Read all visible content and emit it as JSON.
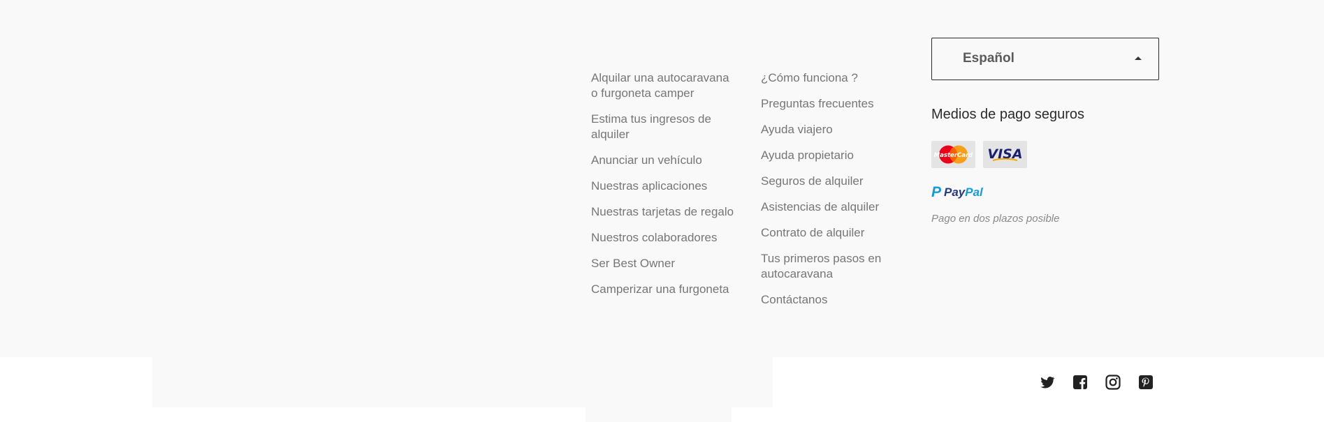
{
  "footer": {
    "column_1": [
      "Alquilar una autocaravana o furgoneta camper",
      "Estima tus ingresos de alquiler",
      "Anunciar un vehículo",
      "Nuestras aplicaciones",
      "Nuestras tarjetas de regalo",
      "Nuestros colaboradores",
      "Ser Best Owner",
      "Camperizar una furgoneta"
    ],
    "column_2": [
      "¿Cómo funciona ?",
      "Preguntas frecuentes",
      "Ayuda viajero",
      "Ayuda propietario",
      "Seguros de alquiler",
      "Asistencias de alquiler",
      "Contrato de alquiler",
      "Tus primeros pasos en autocaravana",
      "Contáctanos"
    ],
    "language": {
      "selected": "Español"
    },
    "payments": {
      "title": "Medios de pago seguros",
      "cards": [
        "MasterCard",
        "VISA"
      ],
      "paypal": {
        "pay": "Pay",
        "pal": "Pal"
      },
      "note": "Pago en dos plazos posible"
    },
    "social_icons": [
      "twitter-icon",
      "facebook-icon",
      "instagram-icon",
      "pinterest-icon"
    ]
  },
  "colors": {
    "background": "#f9f9f9",
    "link": "#767676",
    "paypal_dark": "#253b80",
    "paypal_light": "#179bd7",
    "mastercard_red": "#eb001b",
    "mastercard_orange": "#f79e1b",
    "visa_blue": "#1a1f71"
  }
}
